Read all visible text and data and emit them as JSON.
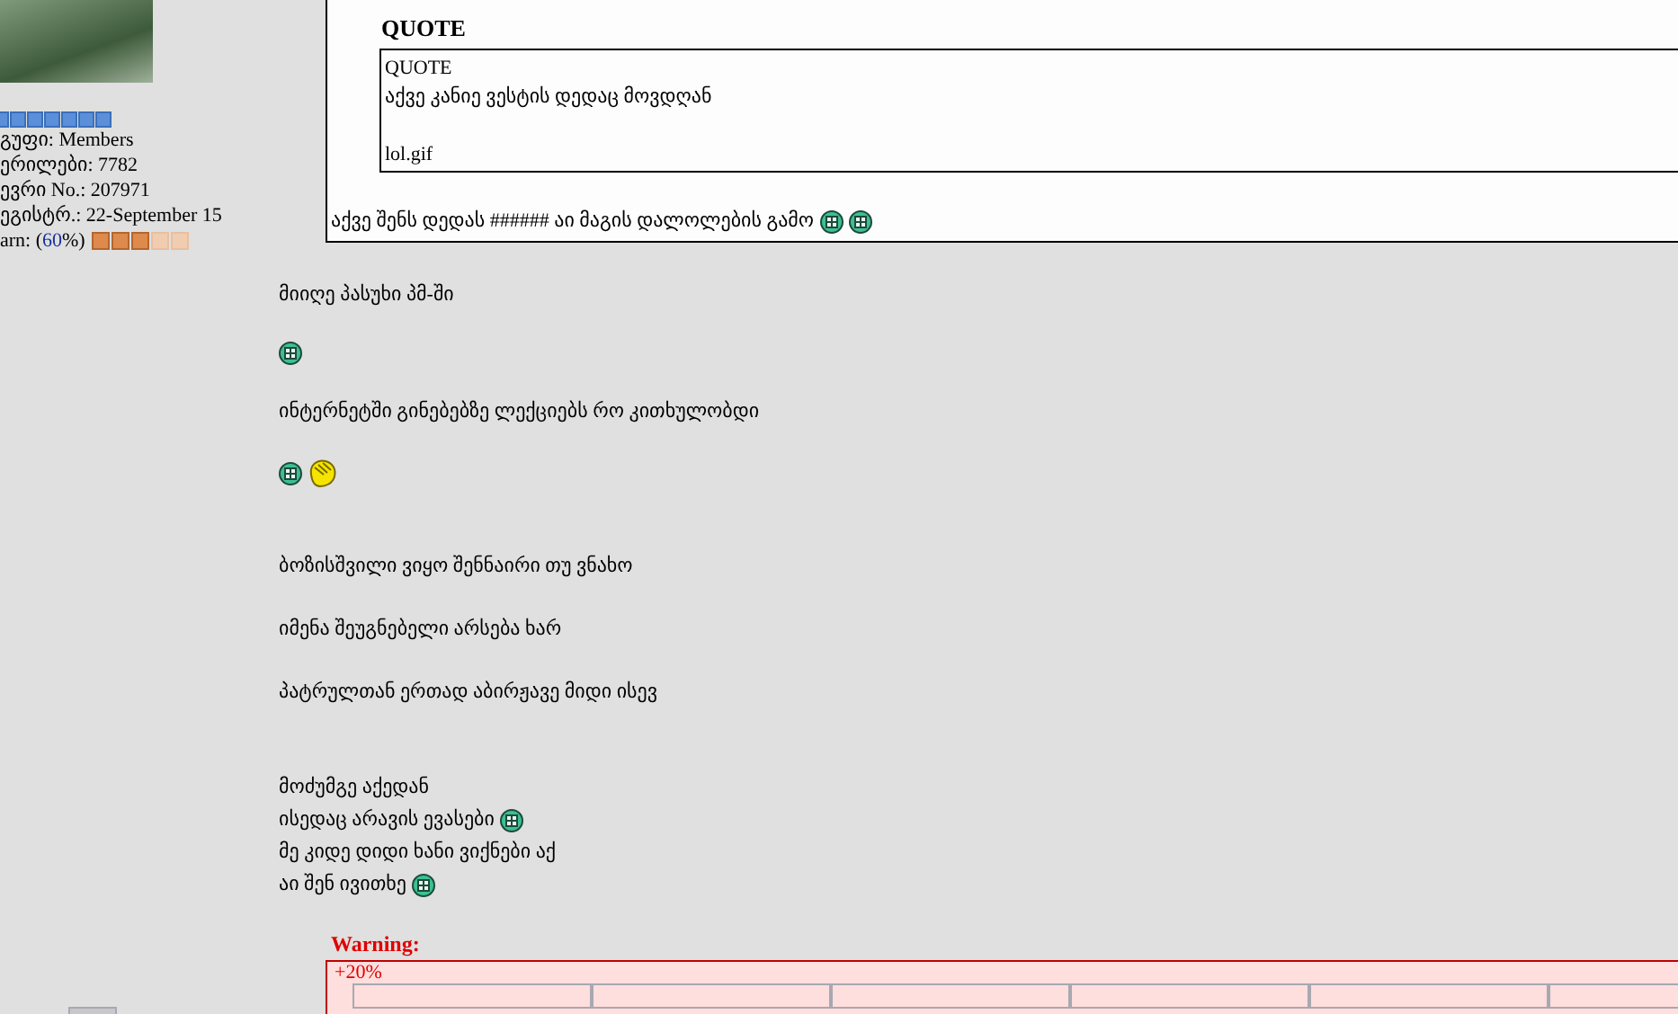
{
  "profile": {
    "details": [
      "გუფი: Members",
      "ერილები: 7782",
      "ევრი No.: 207971",
      "ეგისტრ.: 22-September 15"
    ],
    "warn": {
      "label": "arn: (",
      "percent": "60",
      "suffix": "%)",
      "level": 0.6
    }
  },
  "post": {
    "quote": {
      "header": "QUOTE",
      "inner": {
        "header": "QUOTE",
        "lines": [
          {
            "kind": "text",
            "text": "აქვე კანიე ვესტის დედაც მოვდღან"
          },
          {
            "kind": "blank"
          },
          {
            "kind": "text",
            "text": "lol.gif"
          }
        ]
      },
      "reply": "აქვე შენს დედას ###### აი მაგის დალოლების გამო",
      "emoticons": [
        {
          "kind": "grin"
        },
        {
          "kind": "grin"
        }
      ]
    },
    "blocks": [
      {
        "kind": "para",
        "lines": [
          {
            "text": "მიიღე პასუხი პმ-ში"
          }
        ]
      },
      {
        "kind": "para",
        "lines": [
          {
            "emoticons": [
              {
                "kind": "grin"
              }
            ]
          }
        ]
      },
      {
        "kind": "para",
        "lines": [
          {
            "text": "ინტერნეტში გინებებზე ლექციებს რო კითხულობდი"
          }
        ]
      },
      {
        "kind": "para",
        "lines": [
          {
            "emoticons": [
              {
                "kind": "grin"
              },
              {
                "kind": "facepalm"
              }
            ]
          }
        ]
      },
      {
        "kind": "blank"
      },
      {
        "kind": "para",
        "lines": [
          {
            "text": "ბოზისშვილი ვიყო შენნაირი თუ ვნახო"
          }
        ]
      },
      {
        "kind": "para",
        "lines": [
          {
            "text": "იმენა შეუგნებელი არსება ხარ"
          }
        ]
      },
      {
        "kind": "para",
        "lines": [
          {
            "text": "პატრულთან ერთად აბირჟავე მიდი ისევ"
          }
        ]
      },
      {
        "kind": "blank"
      },
      {
        "kind": "para",
        "lines": [
          {
            "text": "მოძუმგე აქედან"
          },
          {
            "text": "ისედაც არავის ევასები",
            "emoticons": [
              {
                "kind": "grin"
              }
            ]
          },
          {
            "text": "მე კიდე დიდი ხანი ვიქნები აქ"
          },
          {
            "text": "აი შენ ივითხე",
            "emoticons": [
              {
                "kind": "grin"
              }
            ]
          }
        ]
      }
    ]
  },
  "warning": {
    "label": "Warning:",
    "text": "+20%"
  }
}
